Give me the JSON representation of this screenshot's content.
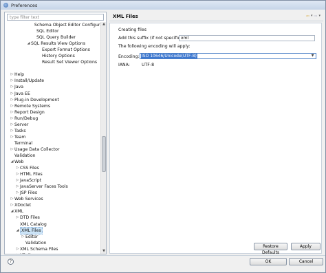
{
  "window": {
    "title": "Preferences"
  },
  "filter": {
    "placeholder": "type filter text"
  },
  "tree": [
    {
      "label": "Schema Object Editor Configuration",
      "indent": 4,
      "toggle": ""
    },
    {
      "label": "SQL Editor",
      "indent": 4,
      "toggle": ""
    },
    {
      "label": "SQL Query Builder",
      "indent": 4,
      "toggle": ""
    },
    {
      "label": "SQL Results View Options",
      "indent": 3,
      "toggle": "open"
    },
    {
      "label": "Export Format Options",
      "indent": 5,
      "toggle": ""
    },
    {
      "label": "History Options",
      "indent": 5,
      "toggle": ""
    },
    {
      "label": "Result Set Viewer Options",
      "indent": 5,
      "toggle": ""
    },
    {
      "label": "",
      "indent": 0,
      "toggle": ""
    },
    {
      "label": "Help",
      "indent": 0,
      "toggle": "closed"
    },
    {
      "label": "Install/Update",
      "indent": 0,
      "toggle": "closed"
    },
    {
      "label": "Java",
      "indent": 0,
      "toggle": "closed"
    },
    {
      "label": "Java EE",
      "indent": 0,
      "toggle": "closed"
    },
    {
      "label": "Plug-in Development",
      "indent": 0,
      "toggle": "closed"
    },
    {
      "label": "Remote Systems",
      "indent": 0,
      "toggle": "closed"
    },
    {
      "label": "Report Design",
      "indent": 0,
      "toggle": "closed"
    },
    {
      "label": "Run/Debug",
      "indent": 0,
      "toggle": "closed"
    },
    {
      "label": "Server",
      "indent": 0,
      "toggle": "closed"
    },
    {
      "label": "Tasks",
      "indent": 0,
      "toggle": "closed"
    },
    {
      "label": "Team",
      "indent": 0,
      "toggle": "closed"
    },
    {
      "label": "Terminal",
      "indent": 0,
      "toggle": ""
    },
    {
      "label": "Usage Data Collector",
      "indent": 0,
      "toggle": "closed"
    },
    {
      "label": "Validation",
      "indent": 0,
      "toggle": ""
    },
    {
      "label": "Web",
      "indent": 0,
      "toggle": "open"
    },
    {
      "label": "CSS Files",
      "indent": 1,
      "toggle": "closed"
    },
    {
      "label": "HTML Files",
      "indent": 1,
      "toggle": "closed"
    },
    {
      "label": "JavaScript",
      "indent": 1,
      "toggle": "closed"
    },
    {
      "label": "JavaServer Faces Tools",
      "indent": 1,
      "toggle": "closed"
    },
    {
      "label": "JSP Files",
      "indent": 1,
      "toggle": "closed"
    },
    {
      "label": "Web Services",
      "indent": 0,
      "toggle": "closed"
    },
    {
      "label": "XDoclet",
      "indent": 0,
      "toggle": "closed"
    },
    {
      "label": "XML",
      "indent": 0,
      "toggle": "open"
    },
    {
      "label": "DTD Files",
      "indent": 1,
      "toggle": "closed"
    },
    {
      "label": "XML Catalog",
      "indent": 1,
      "toggle": ""
    },
    {
      "label": "XML Files",
      "indent": 1,
      "toggle": "open",
      "selected": true
    },
    {
      "label": "Editor",
      "indent": 2,
      "toggle": "closed"
    },
    {
      "label": "Validation",
      "indent": 2,
      "toggle": ""
    },
    {
      "label": "XML Schema Files",
      "indent": 1,
      "toggle": "closed"
    },
    {
      "label": "XPath",
      "indent": 1,
      "toggle": "closed"
    }
  ],
  "page": {
    "title": "XML Files",
    "section": "Creating files",
    "suffix_label": "Add this suffix (if not specified):",
    "suffix_value": "xml",
    "encoding_note": "The following encoding will apply:",
    "encoding_label": "Encoding:",
    "encoding_value": "ISO 10646/Unicode(UTF-8)",
    "iana_label": "IANA:",
    "iana_value": "UTF-8"
  },
  "buttons": {
    "restore": "Restore Defaults",
    "apply": "Apply",
    "ok": "OK",
    "cancel": "Cancel",
    "help": "?"
  },
  "nav_icons": [
    "back-arrow-icon",
    "dropdown-icon",
    "forward-arrow-icon",
    "dropdown-icon"
  ]
}
